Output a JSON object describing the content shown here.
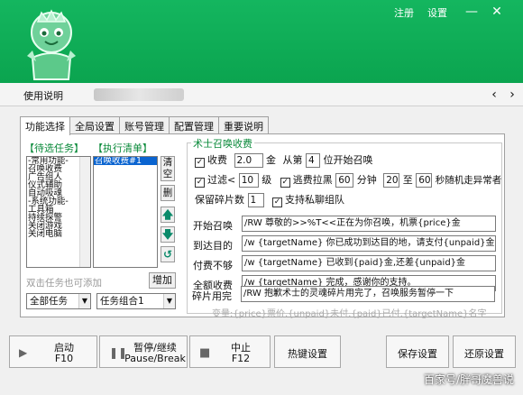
{
  "header": {
    "register_label": "注册",
    "settings_label": "设置",
    "minimize_icon": "minimize-icon",
    "close_icon": "close-icon",
    "accent_color": "#0ba44f"
  },
  "navbar": {
    "help_label": "使用说明",
    "prev_icon": "chevron-left-icon",
    "next_icon": "chevron-right-icon"
  },
  "tabs": [
    {
      "label": "功能选择"
    },
    {
      "label": "全局设置"
    },
    {
      "label": "账号管理"
    },
    {
      "label": "配置管理"
    },
    {
      "label": "重要说明"
    }
  ],
  "task_list": {
    "header": "【待选任务】",
    "items": [
      "-常用功能-",
      "召唤收费",
      "广告组人",
      "仪式辅助",
      "自动吸魂",
      "-系统功能-",
      "工具箱",
      "持续探警",
      "关闭游戏",
      "关闭电脑"
    ],
    "hint": "双击任务也可添加",
    "add_label": "增加",
    "combo_value": "全部任务"
  },
  "exec_list": {
    "header": "【执行清单】",
    "items": [
      "召唤收费#1"
    ],
    "combo_value": "任务组合1",
    "clear_label": "清空",
    "delete_label": "删",
    "up_icon": "arrow-up-icon",
    "down_icon": "arrow-down-icon",
    "loop_icon": "loop-icon"
  },
  "summon": {
    "title": "术士召唤收费",
    "fee_label": "收费",
    "fee_checked": true,
    "fee_value": "2.0",
    "fee_unit": "金",
    "from_label": "从第",
    "position_value": "4",
    "position_suffix": "位开始召唤",
    "filter_label": "过滤<",
    "filter_checked": true,
    "level_value": "10",
    "level_unit": "级",
    "runaway_label": "逃费拉黑",
    "runaway_checked": true,
    "minutes_value": "60",
    "minutes_unit": "分钟",
    "range_from": "20",
    "range_to_label": "至",
    "range_to": "60",
    "range_suffix": "秒随机走异常者",
    "fragments_label": "保留碎片数",
    "fragments_value": "1",
    "private_label": "支持私聊组队",
    "private_checked": true,
    "messages": [
      {
        "label": "开始召唤",
        "value": "/RW 尊敬的>>%T<<正在为你召唤，机票{price}金"
      },
      {
        "label": "到达目的",
        "value": "/w {targetName} 你已成功到达目的地，请支付{unpaid}金"
      },
      {
        "label": "付费不够",
        "value": "/w {targetName} 已收到{paid}金,还差{unpaid}金"
      },
      {
        "label": "全额收费",
        "value": "/w {targetName} 完成，感谢你的支持。"
      },
      {
        "label": "碎片用完",
        "value": "/RW 抱歉术士的灵魂碎片用完了，召唤服务暂停一下"
      }
    ],
    "variables_hint": "变量:{price}票价,{unpaid}未付,{paid}已付,{targetName}名字"
  },
  "toolbar": {
    "start_label": "启动",
    "start_key": "F10",
    "pause_label": "暂停/继续",
    "pause_key": "Pause/Break",
    "stop_label": "中止",
    "stop_key": "F12",
    "hotkey_label": "热键设置",
    "save_label": "保存设置",
    "restore_label": "还原设置"
  },
  "watermark": "百家号/胖哥魔兽说"
}
